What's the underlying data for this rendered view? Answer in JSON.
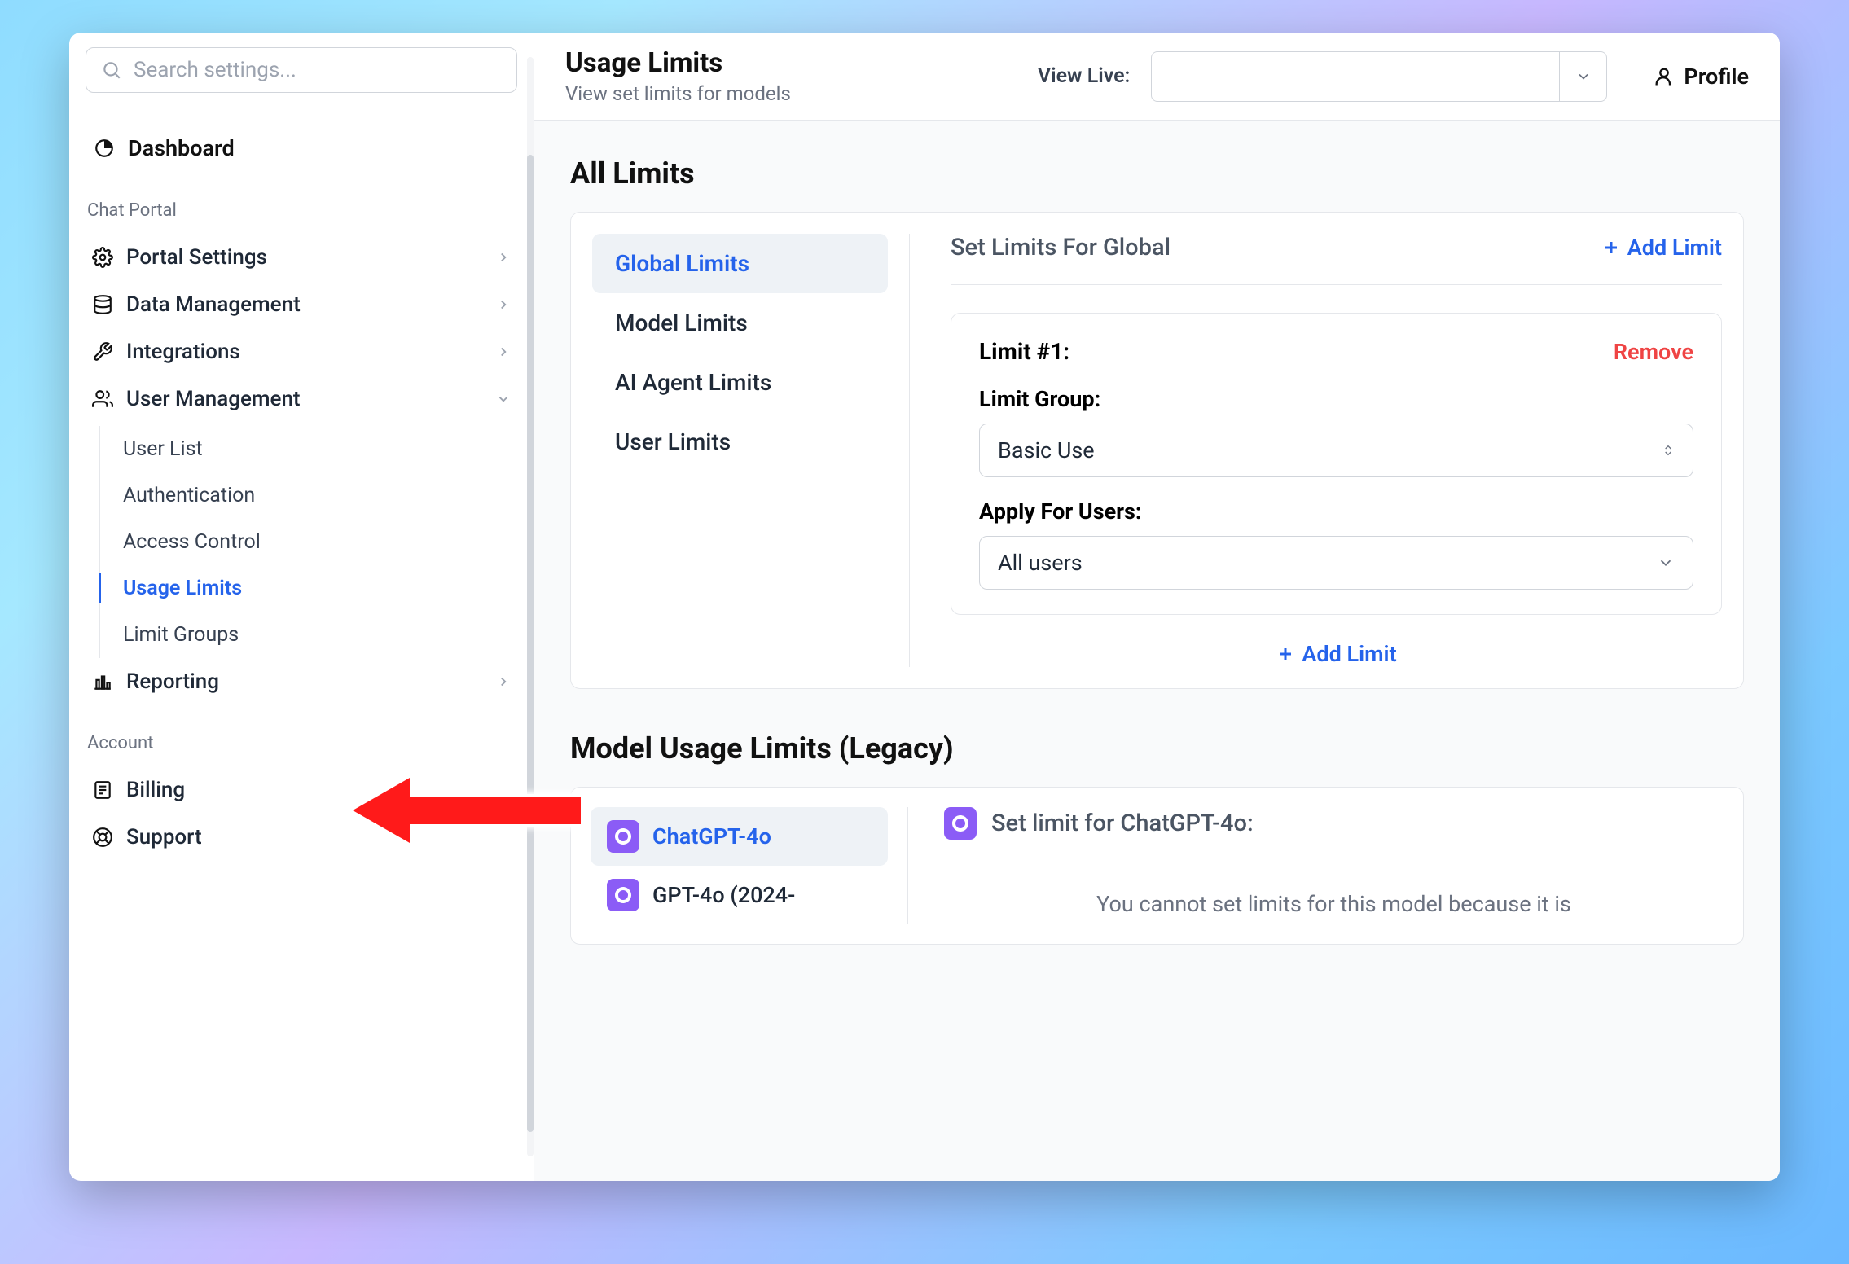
{
  "search": {
    "placeholder": "Search settings..."
  },
  "sidebar": {
    "dashboard": "Dashboard",
    "section_chat_portal": "Chat Portal",
    "portal_settings": "Portal Settings",
    "data_management": "Data Management",
    "integrations": "Integrations",
    "user_management": "User Management",
    "sub_user_list": "User List",
    "sub_authentication": "Authentication",
    "sub_access_control": "Access Control",
    "sub_usage_limits": "Usage Limits",
    "sub_limit_groups": "Limit Groups",
    "reporting": "Reporting",
    "section_account": "Account",
    "billing": "Billing",
    "support": "Support"
  },
  "topbar": {
    "title": "Usage Limits",
    "subtitle": "View set limits for models",
    "view_live_label": "View Live:",
    "profile": "Profile"
  },
  "all_limits": {
    "section_title": "All Limits",
    "tabs": {
      "global": "Global Limits",
      "model": "Model Limits",
      "agent": "AI Agent Limits",
      "user": "User Limits"
    },
    "header": "Set Limits For Global",
    "add_limit": "Add Limit",
    "limit1": {
      "title": "Limit #1:",
      "remove": "Remove",
      "group_label": "Limit Group:",
      "group_value": "Basic Use",
      "apply_label": "Apply For Users:",
      "apply_value": "All users"
    },
    "add_limit_bottom": "Add Limit"
  },
  "legacy": {
    "section_title": "Model Usage Limits (Legacy)",
    "tabs": {
      "chatgpt4o": "ChatGPT-4o",
      "gpt4o_2024": "GPT-4o (2024-"
    },
    "header": "Set limit for ChatGPT-4o:",
    "message": "You cannot set limits for this model because it is"
  }
}
